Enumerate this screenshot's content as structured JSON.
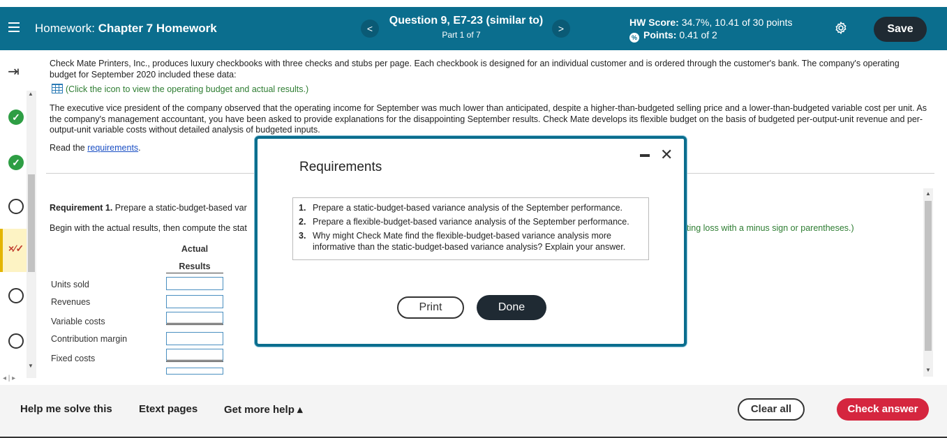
{
  "header": {
    "hw_prefix": "Homework:",
    "hw_title": "Chapter 7 Homework",
    "question_title": "Question 9, E7-23 (similar to)",
    "question_part": "Part 1 of 7",
    "score_label": "HW Score:",
    "score_value": "34.7%, 10.41 of 30 points",
    "points_label": "Points:",
    "points_value": "0.41 of 2",
    "save_label": "Save",
    "prev_label": "<",
    "next_label": ">"
  },
  "problem": {
    "intro": "Check Mate Printers, Inc., produces luxury checkbooks with three checks and stubs per page. Each checkbook is designed for an individual customer and is ordered through the customer's bank. The company's operating budget for September 2020 included these data:",
    "click_icon": "(Click the icon to view the operating budget and actual results.)",
    "paragraph2": "The executive vice president of the company observed that the operating income for September was much lower than anticipated, despite a higher-than-budgeted selling price and a lower-than-budgeted variable cost per unit. As the company's management accountant, you have been asked to provide explanations for the disappointing September results. Check Mate develops its flexible budget on the basis of budgeted per-output-unit revenue and per-output-unit variable costs without detailed analysis of budgeted inputs.",
    "read_prefix": "Read the",
    "read_link": "requirements",
    "read_suffix": ".",
    "req1_label": "Requirement 1.",
    "req1_text": "Prepare a static-budget-based var",
    "begin_text": "Begin with the actual results, then compute the stat",
    "green_note": "ting loss with a minus sign or parentheses.)"
  },
  "table": {
    "col_header_1": "Actual",
    "col_header_2": "Results",
    "rows": [
      "Units sold",
      "Revenues",
      "Variable costs",
      "Contribution margin",
      "Fixed costs"
    ]
  },
  "modal": {
    "title": "Requirements",
    "items": [
      {
        "n": "1.",
        "text": "Prepare a static-budget-based variance analysis of the September performance."
      },
      {
        "n": "2.",
        "text": "Prepare a flexible-budget-based variance analysis of the September performance."
      },
      {
        "n": "3.",
        "text": "Why might Check Mate find the flexible-budget-based variance analysis more informative than the static-budget-based variance analysis? Explain your answer."
      }
    ],
    "print_label": "Print",
    "done_label": "Done"
  },
  "footer": {
    "help": "Help me solve this",
    "etext": "Etext pages",
    "more_help": "Get more help ▴",
    "clear_all": "Clear all",
    "check_answer": "Check answer"
  },
  "colors": {
    "header_bg": "#0b6e8e",
    "check_answer_bg": "#d5263f",
    "correct_green": "#2e9e44"
  }
}
